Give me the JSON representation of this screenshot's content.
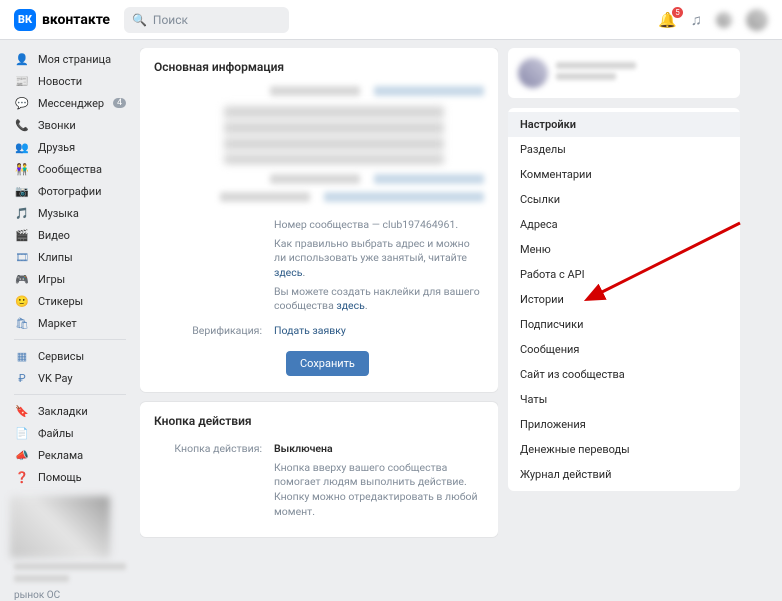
{
  "header": {
    "brand": "вконтакте",
    "logo_text": "ВК",
    "search_placeholder": "Поиск",
    "bell_badge": "5"
  },
  "sidebar": {
    "groups": [
      [
        {
          "icon": "👤",
          "label": "Моя страница"
        },
        {
          "icon": "📰",
          "label": "Новости"
        },
        {
          "icon": "💬",
          "label": "Мессенджер",
          "badge": "4"
        },
        {
          "icon": "📞",
          "label": "Звонки"
        },
        {
          "icon": "👥",
          "label": "Друзья"
        },
        {
          "icon": "👫",
          "label": "Сообщества"
        },
        {
          "icon": "📷",
          "label": "Фотографии"
        },
        {
          "icon": "🎵",
          "label": "Музыка"
        },
        {
          "icon": "🎬",
          "label": "Видео"
        },
        {
          "icon": "🎞",
          "label": "Клипы"
        },
        {
          "icon": "🎮",
          "label": "Игры"
        },
        {
          "icon": "🙂",
          "label": "Стикеры"
        },
        {
          "icon": "🛍",
          "label": "Маркет"
        }
      ],
      [
        {
          "icon": "▦",
          "label": "Сервисы"
        },
        {
          "icon": "₽",
          "label": "VK Pay"
        }
      ],
      [
        {
          "icon": "🔖",
          "label": "Закладки"
        },
        {
          "icon": "📄",
          "label": "Файлы"
        },
        {
          "icon": "📣",
          "label": "Реклама"
        },
        {
          "icon": "❓",
          "label": "Помощь"
        }
      ]
    ],
    "ad_label": "рынок ОС"
  },
  "main": {
    "section1_title": "Основная информация",
    "club_id_text": "Номер сообщества — club197464961.",
    "hint1_a": "Как правильно выбрать адрес и можно ли использовать уже занятый, читайте ",
    "hint1_link": "здесь",
    "hint1_b": ".",
    "hint2_a": "Вы можете создать наклейки для вашего сообщества ",
    "hint2_link": "здесь",
    "hint2_b": ".",
    "verification_label": "Верификация:",
    "verification_action": "Подать заявку",
    "save_btn": "Сохранить",
    "section2_title": "Кнопка действия",
    "action_label": "Кнопка действия:",
    "action_value": "Выключена",
    "action_hint": "Кнопка вверху вашего сообщества помогает людям выполнить действие. Кнопку можно отредактировать в любой момент."
  },
  "right_menu": {
    "items": [
      {
        "label": "Настройки",
        "active": true
      },
      {
        "label": "Разделы"
      },
      {
        "label": "Комментарии"
      },
      {
        "label": "Ссылки"
      },
      {
        "label": "Адреса"
      },
      {
        "label": "Меню"
      },
      {
        "label": "Работа с API"
      },
      {
        "label": "Истории"
      },
      {
        "label": "Подписчики"
      },
      {
        "label": "Сообщения"
      },
      {
        "label": "Сайт из сообщества"
      },
      {
        "label": "Чаты"
      },
      {
        "label": "Приложения"
      },
      {
        "label": "Денежные переводы"
      },
      {
        "label": "Журнал действий"
      }
    ]
  },
  "colors": {
    "accent": "#447bba"
  }
}
